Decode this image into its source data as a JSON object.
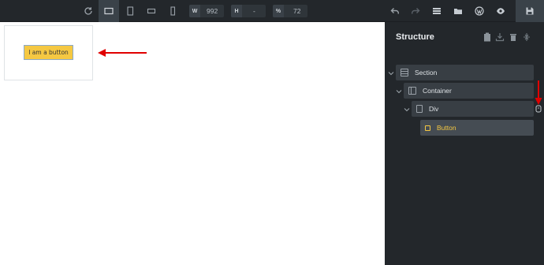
{
  "toolbar": {
    "width_label": "W",
    "width_value": "992",
    "height_label": "H",
    "height_value": "-",
    "zoom_label": "%",
    "zoom_value": "72"
  },
  "canvas": {
    "button_label": "I am a button"
  },
  "structure": {
    "title": "Structure",
    "items": [
      {
        "label": "Section"
      },
      {
        "label": "Container"
      },
      {
        "label": "Div"
      },
      {
        "label": "Button"
      }
    ]
  },
  "colors": {
    "accent": "#f5c842",
    "panel_bg": "#23272b",
    "arrow": "#e00000"
  }
}
